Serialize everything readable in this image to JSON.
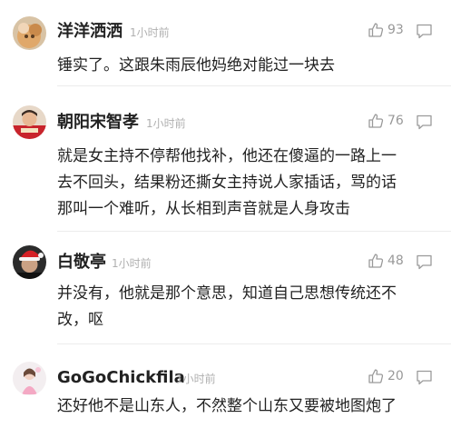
{
  "comments": [
    {
      "username": "洋洋洒洒",
      "time": "1小时前",
      "likes": "93",
      "avatar_icon": "cat-photo-avatar",
      "lines": [
        "锤实了。这跟朱雨辰他妈绝对能过一块去"
      ]
    },
    {
      "username": "朝阳宋智孝",
      "time": "1小时前",
      "likes": "76",
      "avatar_icon": "person-red-photo-avatar",
      "lines": [
        "就是女主持不停帮他找补，他还在傻逼的一路上一",
        "去不回头，结果粉还撕女主持说人家插话，骂的话",
        "那叫一个难听，从长相到声音就是人身攻击"
      ]
    },
    {
      "username": "白敬亭",
      "time": "1小时前",
      "likes": "48",
      "avatar_icon": "man-santa-hat-avatar",
      "lines": [
        "并没有，他就是那个意思，知道自己思想传统还不",
        "改，呕"
      ]
    },
    {
      "username": "GoGoChickfila",
      "time": "1小时前",
      "likes": "20",
      "avatar_icon": "girl-pink-photo-avatar",
      "lines": [
        "还好他不是山东人，不然整个山东又要被地图炮了"
      ]
    }
  ],
  "colors": {
    "text": "#222222",
    "meta": "#b0b0b0",
    "icon": "#9a9a9a",
    "divider": "#ececec"
  }
}
